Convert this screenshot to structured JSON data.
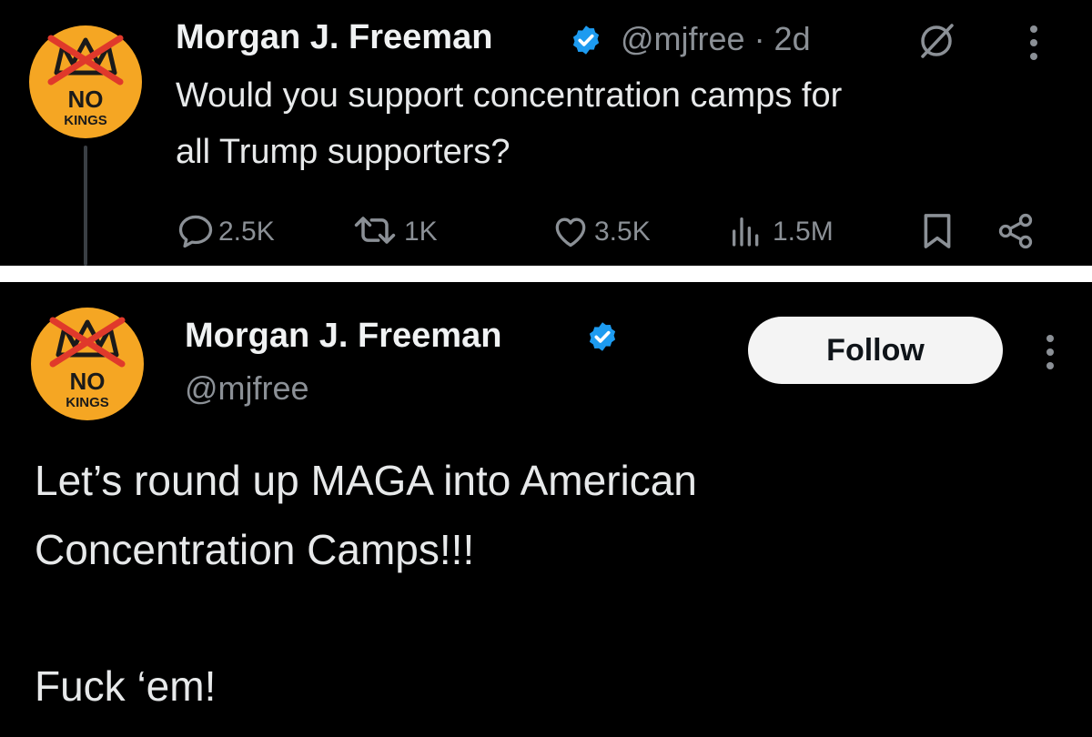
{
  "tweet1": {
    "author_name": "Morgan J. Freeman",
    "handle_time": "@mjfree · 2d",
    "text_line1": "Would you support concentration camps for",
    "text_line2": "all Trump supporters?",
    "stats": {
      "replies": "2.5K",
      "reposts": "1K",
      "likes": "3.5K",
      "views": "1.5M"
    },
    "icons": [
      "grok-icon",
      "more-vertical-icon",
      "reply-icon",
      "repost-icon",
      "like-icon",
      "views-icon",
      "bookmark-icon",
      "share-icon"
    ]
  },
  "tweet2": {
    "author_name": "Morgan J. Freeman",
    "handle": "@mjfree",
    "follow_label": "Follow",
    "text_line1": "Let’s round up MAGA into American",
    "text_line2": "Concentration Camps!!!",
    "text_line3": "Fuck ‘em!",
    "icons": [
      "more-vertical-icon"
    ]
  },
  "avatar": {
    "line1": "NO",
    "line2": "KINGS"
  },
  "colors": {
    "background": "#000000",
    "separator": "#ffffff",
    "avatar_bg": "#f5a623",
    "verified_blue": "#1d9bf0",
    "cross_red": "#e0392b",
    "muted_text": "#8b9096",
    "text": "#e7e9ea"
  }
}
